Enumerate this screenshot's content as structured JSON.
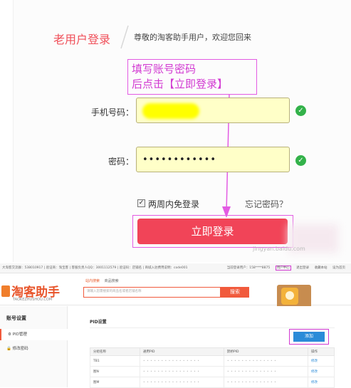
{
  "login": {
    "title": "老用户登录",
    "subtitle": "尊敬的淘客助手用户，欢迎您回来",
    "annotation_line1": "填写账号密码",
    "annotation_line2": "后点击【立即登录】",
    "phone_label": "手机号码：",
    "password_label": "密码：",
    "password_value": "••••••••••••",
    "remember_label": "两周内免登录",
    "remember_checked": true,
    "forgot_label": "忘记密码？",
    "submit_label": "立即登录",
    "watermark": "jingyan.baidu.com",
    "colors": {
      "accent": "#f14458",
      "annotation": "#d23ad2",
      "field_bg": "#ffffc8",
      "ok": "#33b24a"
    }
  },
  "site": {
    "topbar_left": "大淘客交流群：538010917 | 验证商：淘宝客 | 客服负责人QQ：3001112579 | 验证码：店铺名 | 商城入驻费用说明：code001",
    "topbar_right": [
      "当前登录用户：158****8875",
      "用户中心",
      "退出登录",
      "收藏本站",
      "设为首页"
    ],
    "topbar_highlight_index": 1,
    "logo_text": "淘客助手",
    "logo_sub": "TAOKEZHUSHOU.COM",
    "search_tabs": [
      "站内搜索",
      "商品搜索"
    ],
    "search_placeholder": "请输入您需搜索的商品名或者店铺名称",
    "search_button": "搜索"
  },
  "sidebar": {
    "title": "账号设置",
    "items": [
      {
        "label": "PID管理",
        "icon": "settings-icon",
        "active": true
      },
      {
        "label": "修改密码",
        "icon": "lock-icon",
        "active": false
      }
    ]
  },
  "main": {
    "title": "PID设置",
    "add_button": "添加",
    "columns": [
      "分组名称",
      "通用PID",
      "鹊桥PID",
      "操作"
    ],
    "rows": [
      [
        "TB1",
        "• • • • • • • • • • • • • • • •",
        "• • • • • • • • • • • • • •",
        "修改"
      ],
      [
        "图N",
        "• • • • • • • • • • • • • • • •",
        "• • • • • • • • • • • • • •",
        "修改"
      ],
      [
        "图M",
        "• • • • • • • • • • • • • • • •",
        "• • • • • • • • • • • • • •",
        "修改"
      ]
    ]
  }
}
